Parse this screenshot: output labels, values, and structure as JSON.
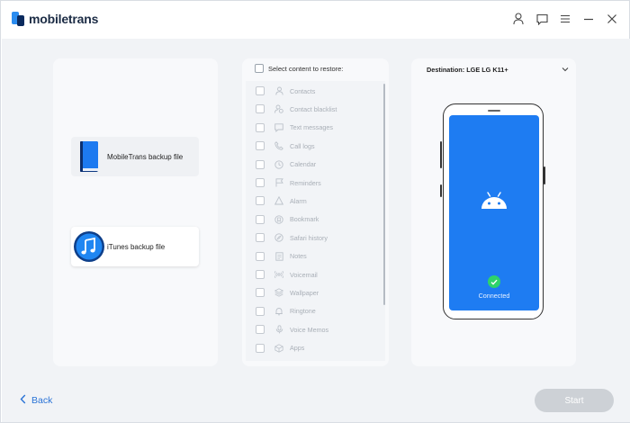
{
  "app": {
    "brand_name": "mobiletrans"
  },
  "window_controls": [
    "account-icon",
    "feedback-icon",
    "menu-icon",
    "minimize-icon",
    "close-icon"
  ],
  "sources": [
    {
      "label": "MobileTrans backup file",
      "icon": "backup-book-icon",
      "selected": false
    },
    {
      "label": "iTunes backup file",
      "icon": "itunes-music-icon",
      "selected": true
    }
  ],
  "content": {
    "header_label": "Select content to restore:",
    "items": [
      {
        "label": "Contacts",
        "icon": "person-icon"
      },
      {
        "label": "Contact blacklist",
        "icon": "person-block-icon"
      },
      {
        "label": "Text messages",
        "icon": "message-icon"
      },
      {
        "label": "Call logs",
        "icon": "phone-icon"
      },
      {
        "label": "Calendar",
        "icon": "calendar-icon"
      },
      {
        "label": "Reminders",
        "icon": "flag-icon"
      },
      {
        "label": "Alarm",
        "icon": "alarm-icon"
      },
      {
        "label": "Bookmark",
        "icon": "bookmark-icon"
      },
      {
        "label": "Safari history",
        "icon": "compass-icon"
      },
      {
        "label": "Notes",
        "icon": "notes-icon"
      },
      {
        "label": "Voicemail",
        "icon": "voicemail-icon"
      },
      {
        "label": "Wallpaper",
        "icon": "layers-icon"
      },
      {
        "label": "Ringtone",
        "icon": "bell-icon"
      },
      {
        "label": "Voice Memos",
        "icon": "mic-icon"
      },
      {
        "label": "Apps",
        "icon": "apps-icon"
      }
    ]
  },
  "destination": {
    "label": "Destination: LGE LG K11+",
    "status": "Connected",
    "platform_icon": "android-icon"
  },
  "footer": {
    "back_label": "Back",
    "start_label": "Start"
  },
  "colors": {
    "accent": "#2a73d6",
    "phone_screen": "#1e7cf2",
    "connected_badge": "#2ed36a",
    "start_disabled": "#cdd1d6"
  }
}
